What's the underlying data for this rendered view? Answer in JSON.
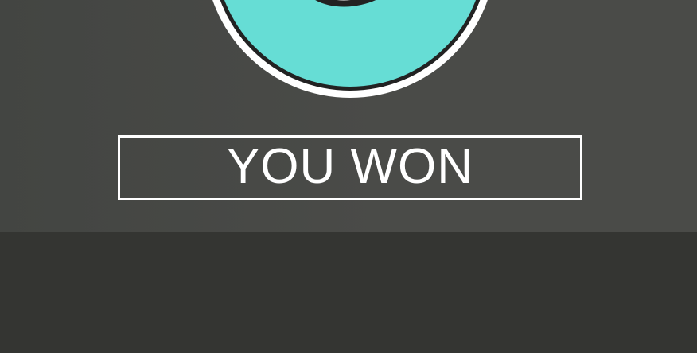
{
  "game": {
    "result_text": "YOU WON",
    "emblem_icon": "ring-emblem-icon"
  },
  "colors": {
    "top_panel": "#4a4b48",
    "bottom_panel": "#343532",
    "emblem_fill": "#66ddd5",
    "emblem_outline": "#222222",
    "text": "#ffffff",
    "border": "#ffffff"
  }
}
